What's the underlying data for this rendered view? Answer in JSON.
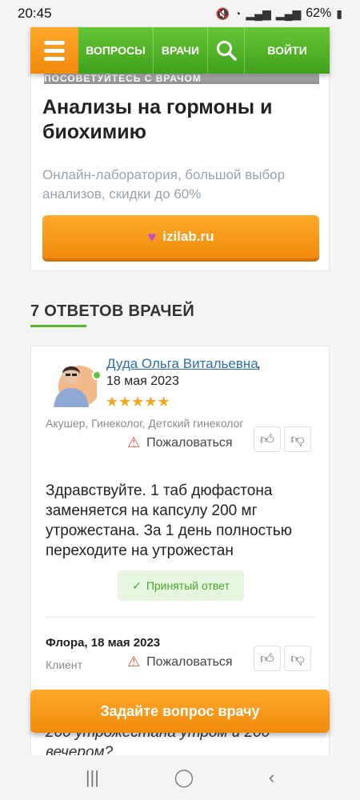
{
  "status_bar": {
    "time": "20:45",
    "battery": "62%",
    "icons": [
      "mute-icon",
      "wifi-icon",
      "signal-icon",
      "signal-icon",
      "battery-icon"
    ]
  },
  "nav": {
    "menu_icon": "hamburger-icon",
    "questions": "ВОПРОСЫ",
    "doctors": "ВРАЧИ",
    "search_icon": "search-icon",
    "login": "ВОЙТИ"
  },
  "ad": {
    "strip_text": "ПОСОВЕТУЙТЕСЬ С ВРАЧОМ",
    "title": "Анализы на гормоны и биохимию",
    "description": "Онлайн-лаборатория, большой выбор анализов, скидки до 60%",
    "button_label": "izilab.ru",
    "button_icon": "heart-icon"
  },
  "answers": {
    "heading": "7 ОТВЕТОВ ВРАЧЕЙ",
    "doctor_answer": {
      "name": "Дуда Ольга Витальевна",
      "comma": ",",
      "date": "18 мая 2023",
      "stars": "★★★★★",
      "rating": 5,
      "specialization": "Акушер, Гинеколог, Детский гинеколог",
      "complain_label": "Пожаловаться",
      "text": "Здравствуйте. 1 таб дюфастона заменяется на капсулу 200 мг утрожестана. За 1 день полностью переходите на утрожестан",
      "accepted_label": "Принятый ответ"
    },
    "client_reply": {
      "name_date": "Флора, 18 мая 2023",
      "role": "Клиент",
      "complain_label": "Пожаловаться",
      "text": "200 утрожестана утром и 200 вечером?"
    }
  },
  "cta": {
    "label": "Задайте вопрос врачу"
  },
  "system_nav": {
    "recents": "|||",
    "home": "◯",
    "back": "‹"
  }
}
